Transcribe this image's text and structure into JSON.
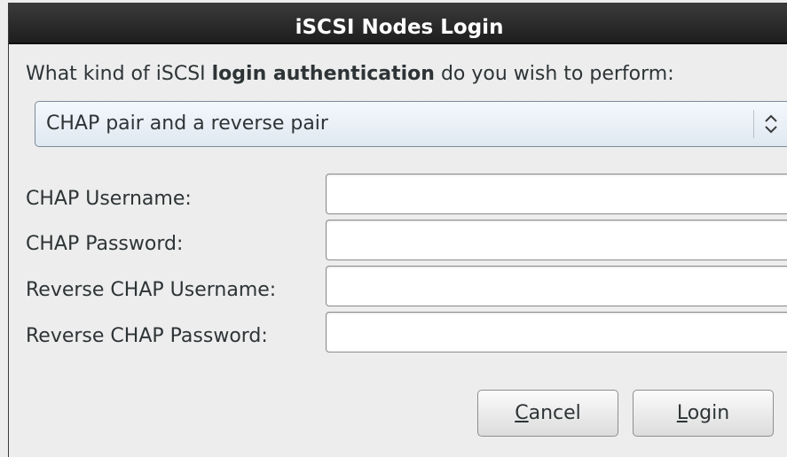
{
  "dialog": {
    "title": "iSCSI Nodes Login"
  },
  "auth_question": {
    "prefix": "What kind of iSCSI ",
    "emphasis": "login authentication",
    "suffix": " do you wish to perform:"
  },
  "auth_select": {
    "selected": "CHAP pair and a reverse pair",
    "icon": "up-down-arrows-icon"
  },
  "fields": [
    {
      "label": "CHAP Username:",
      "value": ""
    },
    {
      "label": "CHAP Password:",
      "value": ""
    },
    {
      "label": "Reverse CHAP Username:",
      "value": ""
    },
    {
      "label": "Reverse CHAP Password:",
      "value": ""
    }
  ],
  "buttons": {
    "cancel": {
      "mnemonic": "C",
      "rest": "ancel"
    },
    "login": {
      "mnemonic": "L",
      "rest": "ogin"
    }
  }
}
